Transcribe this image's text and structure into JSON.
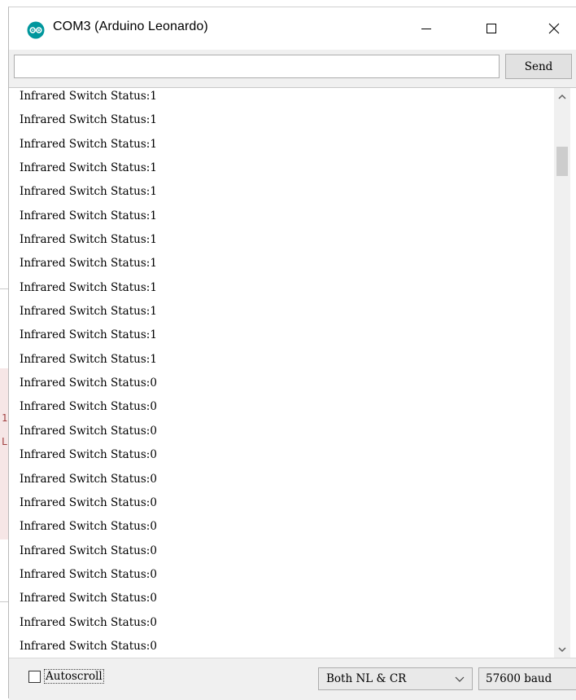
{
  "window": {
    "title": "COM3 (Arduino Leonardo)",
    "icon": "arduino-logo-icon",
    "accent_color": "#00979d"
  },
  "input": {
    "value": "",
    "placeholder": "",
    "send_label": "Send"
  },
  "output": {
    "lines": [
      "Infrared Switch Status:1",
      "Infrared Switch Status:1",
      "Infrared Switch Status:1",
      "Infrared Switch Status:1",
      "Infrared Switch Status:1",
      "Infrared Switch Status:1",
      "Infrared Switch Status:1",
      "Infrared Switch Status:1",
      "Infrared Switch Status:1",
      "Infrared Switch Status:1",
      "Infrared Switch Status:1",
      "Infrared Switch Status:1",
      "Infrared Switch Status:0",
      "Infrared Switch Status:0",
      "Infrared Switch Status:0",
      "Infrared Switch Status:0",
      "Infrared Switch Status:0",
      "Infrared Switch Status:0",
      "Infrared Switch Status:0",
      "Infrared Switch Status:0",
      "Infrared Switch Status:0",
      "Infrared Switch Status:0",
      "Infrared Switch Status:0",
      "Infrared Switch Status:0"
    ]
  },
  "bottom": {
    "autoscroll_label": "Autoscroll",
    "autoscroll_checked": false,
    "line_ending": "Both NL & CR",
    "baud": "57600 baud"
  },
  "background": {
    "edge_glyph_1": "1",
    "edge_glyph_2": "L"
  }
}
